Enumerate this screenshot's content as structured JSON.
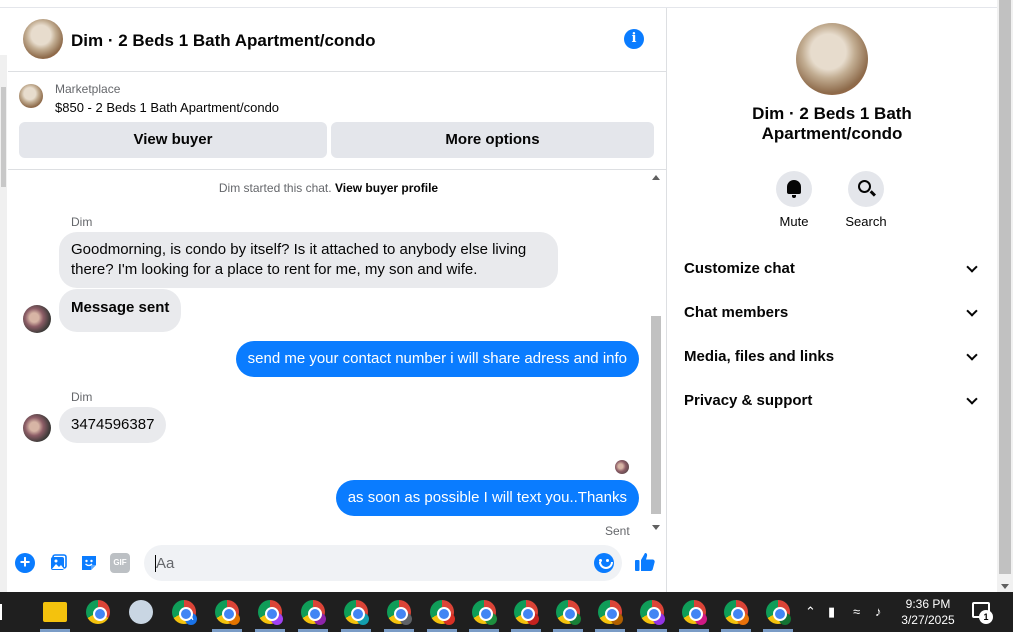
{
  "chat": {
    "title": "Dim · 2 Beds 1 Bath Apartment/condo",
    "marketplace_label": "Marketplace",
    "listing": "$850 - 2 Beds 1 Bath Apartment/condo",
    "view_buyer": "View buyer",
    "more_options": "More options",
    "started_text": "Dim started this chat.",
    "view_buyer_profile": "View buyer profile",
    "messages": [
      {
        "sender": "Dim",
        "text": "Goodmorning, is condo by itself? Is it attached to anybody else living there? I'm looking for a place to rent for me, my son and wife."
      },
      {
        "text": "Message sent"
      },
      {
        "text": "send me your contact number i will share adress and info"
      },
      {
        "sender": "Dim",
        "text": "3474596387"
      },
      {
        "text": "as soon as possible I will text you..Thanks"
      }
    ],
    "status": "Sent",
    "composer_placeholder": "Aa",
    "gif_label": "GIF"
  },
  "panel": {
    "title": "Dim · 2 Beds 1 Bath Apartment/condo",
    "mute": "Mute",
    "search": "Search",
    "sections": [
      "Customize chat",
      "Chat members",
      "Media, files and links",
      "Privacy & support"
    ]
  },
  "taskbar": {
    "time": "9:36 PM",
    "date": "3/27/2025",
    "notification_count": "1",
    "profile_badge": "A"
  },
  "colors": {
    "accent": "#0a7cff",
    "bubble_incoming": "#e9eaed"
  }
}
